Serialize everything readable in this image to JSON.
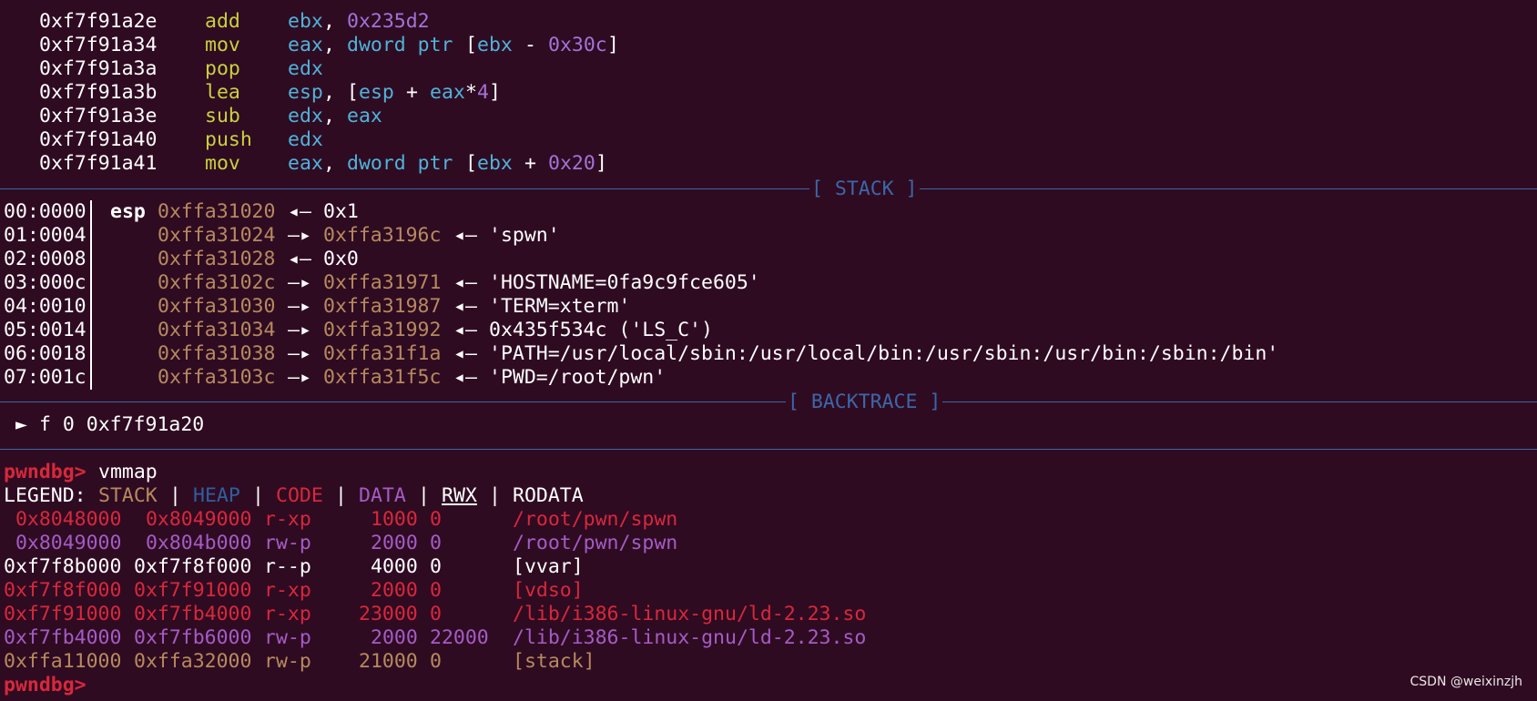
{
  "disasm": [
    {
      "addr": "0xf7f91a2e",
      "mnemonic": "add",
      "ops": [
        {
          "t": "ebx",
          "c": "cyan"
        },
        {
          "t": ", ",
          "c": "white"
        },
        {
          "t": "0x235d2",
          "c": "purple"
        }
      ]
    },
    {
      "addr": "0xf7f91a34",
      "mnemonic": "mov",
      "ops": [
        {
          "t": "eax",
          "c": "cyan"
        },
        {
          "t": ", ",
          "c": "white"
        },
        {
          "t": "dword ptr",
          "c": "cyan"
        },
        {
          "t": " [",
          "c": "white"
        },
        {
          "t": "ebx",
          "c": "cyan"
        },
        {
          "t": " - ",
          "c": "white"
        },
        {
          "t": "0x30c",
          "c": "purple"
        },
        {
          "t": "]",
          "c": "white"
        }
      ]
    },
    {
      "addr": "0xf7f91a3a",
      "mnemonic": "pop",
      "ops": [
        {
          "t": "edx",
          "c": "cyan"
        }
      ]
    },
    {
      "addr": "0xf7f91a3b",
      "mnemonic": "lea",
      "ops": [
        {
          "t": "esp",
          "c": "cyan"
        },
        {
          "t": ", [",
          "c": "white"
        },
        {
          "t": "esp",
          "c": "cyan"
        },
        {
          "t": " + ",
          "c": "white"
        },
        {
          "t": "eax",
          "c": "cyan"
        },
        {
          "t": "*",
          "c": "white"
        },
        {
          "t": "4",
          "c": "purple"
        },
        {
          "t": "]",
          "c": "white"
        }
      ]
    },
    {
      "addr": "0xf7f91a3e",
      "mnemonic": "sub",
      "ops": [
        {
          "t": "edx",
          "c": "cyan"
        },
        {
          "t": ", ",
          "c": "white"
        },
        {
          "t": "eax",
          "c": "cyan"
        }
      ]
    },
    {
      "addr": "0xf7f91a40",
      "mnemonic": "push",
      "ops": [
        {
          "t": "edx",
          "c": "cyan"
        }
      ]
    },
    {
      "addr": "0xf7f91a41",
      "mnemonic": "mov",
      "ops": [
        {
          "t": "eax",
          "c": "cyan"
        },
        {
          "t": ", ",
          "c": "white"
        },
        {
          "t": "dword ptr",
          "c": "cyan"
        },
        {
          "t": " [",
          "c": "white"
        },
        {
          "t": "ebx",
          "c": "cyan"
        },
        {
          "t": " + ",
          "c": "white"
        },
        {
          "t": "0x20",
          "c": "purple"
        },
        {
          "t": "]",
          "c": "white"
        }
      ]
    }
  ],
  "stack_header": "[ STACK ]",
  "stack": [
    {
      "idx": "00:0000",
      "reg": "esp",
      "addr": "0xffa31020",
      "ptr": "",
      "arrow1": "◂—",
      "value": "0x1"
    },
    {
      "idx": "01:0004",
      "reg": "",
      "addr": "0xffa31024",
      "arrow0": "—▸",
      "ptr": "0xffa3196c",
      "arrow1": "◂—",
      "value": "'spwn'"
    },
    {
      "idx": "02:0008",
      "reg": "",
      "addr": "0xffa31028",
      "ptr": "",
      "arrow1": "◂—",
      "value": "0x0"
    },
    {
      "idx": "03:000c",
      "reg": "",
      "addr": "0xffa3102c",
      "arrow0": "—▸",
      "ptr": "0xffa31971",
      "arrow1": "◂—",
      "value": "'HOSTNAME=0fa9c9fce605'"
    },
    {
      "idx": "04:0010",
      "reg": "",
      "addr": "0xffa31030",
      "arrow0": "—▸",
      "ptr": "0xffa31987",
      "arrow1": "◂—",
      "value": "'TERM=xterm'"
    },
    {
      "idx": "05:0014",
      "reg": "",
      "addr": "0xffa31034",
      "arrow0": "—▸",
      "ptr": "0xffa31992",
      "arrow1": "◂—",
      "value": "0x435f534c ('LS_C')"
    },
    {
      "idx": "06:0018",
      "reg": "",
      "addr": "0xffa31038",
      "arrow0": "—▸",
      "ptr": "0xffa31f1a",
      "arrow1": "◂—",
      "value": "'PATH=/usr/local/sbin:/usr/local/bin:/usr/sbin:/usr/bin:/sbin:/bin'"
    },
    {
      "idx": "07:001c",
      "reg": "",
      "addr": "0xffa3103c",
      "arrow0": "—▸",
      "ptr": "0xffa31f5c",
      "arrow1": "◂—",
      "value": "'PWD=/root/pwn'"
    }
  ],
  "backtrace_header": "[ BACKTRACE ]",
  "backtrace": {
    "marker": "►",
    "text": "f 0 0xf7f91a20"
  },
  "prompt": "pwndbg>",
  "command": "vmmap",
  "legend": {
    "prefix": "LEGEND: ",
    "items": [
      {
        "t": "STACK",
        "c": "brown"
      },
      {
        "t": "HEAP",
        "c": "blue"
      },
      {
        "t": "CODE",
        "c": "red"
      },
      {
        "t": "DATA",
        "c": "magenta"
      },
      {
        "t": "RWX",
        "c": "white",
        "underline": true
      },
      {
        "t": "RODATA",
        "c": "white"
      }
    ],
    "sep": " | "
  },
  "vmmap": [
    {
      "start": " 0x8048000",
      "end": " 0x8049000",
      "perm": "r-xp",
      "size": "1000",
      "offset": "0",
      "file": "/root/pwn/spwn",
      "c": "red"
    },
    {
      "start": " 0x8049000",
      "end": " 0x804b000",
      "perm": "rw-p",
      "size": "2000",
      "offset": "0",
      "file": "/root/pwn/spwn",
      "c": "magenta"
    },
    {
      "start": "0xf7f8b000",
      "end": "0xf7f8f000",
      "perm": "r--p",
      "size": "4000",
      "offset": "0",
      "file": "[vvar]",
      "c": "white"
    },
    {
      "start": "0xf7f8f000",
      "end": "0xf7f91000",
      "perm": "r-xp",
      "size": "2000",
      "offset": "0",
      "file": "[vdso]",
      "c": "red"
    },
    {
      "start": "0xf7f91000",
      "end": "0xf7fb4000",
      "perm": "r-xp",
      "size": "23000",
      "offset": "0",
      "file": "/lib/i386-linux-gnu/ld-2.23.so",
      "c": "red"
    },
    {
      "start": "0xf7fb4000",
      "end": "0xf7fb6000",
      "perm": "rw-p",
      "size": "2000",
      "offset": "22000",
      "file": "/lib/i386-linux-gnu/ld-2.23.so",
      "c": "magenta"
    },
    {
      "start": "0xffa11000",
      "end": "0xffa32000",
      "perm": "rw-p",
      "size": "21000",
      "offset": "0",
      "file": "[stack]",
      "c": "brown"
    }
  ],
  "final_prompt": "pwndbg>",
  "watermark": "CSDN @weixinzjh",
  "colors": {
    "background": "#2f0b22",
    "white": "#ffffff",
    "yellow": "#c8d13e",
    "cyan": "#4fb3d9",
    "purple": "#a472d6",
    "brown": "#b68a5e",
    "red": "#d8283b",
    "blue": "#2e5f9e",
    "magenta": "#a45cc4",
    "rule": "#3c67a8"
  }
}
